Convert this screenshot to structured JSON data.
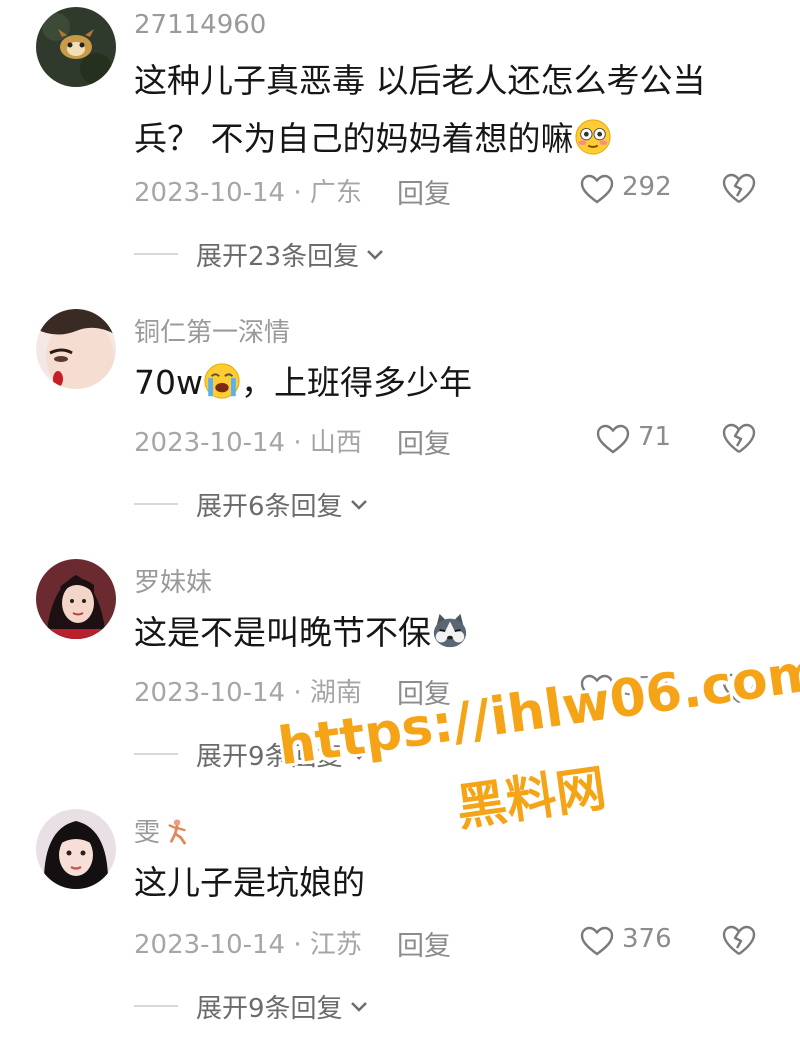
{
  "comments": [
    {
      "username": "27114960",
      "text": "这种儿子真恶毒 以后老人还怎么考公当兵？ 不为自己的妈妈着想的嘛",
      "emoji": "flushed-face-emoji",
      "date_location": "2023-10-14 · 广东",
      "reply_label": "回复",
      "likes": "292",
      "expand_label": "展开23条回复"
    },
    {
      "username": "铜仁第一深情",
      "text_before": "70w",
      "emoji": "loudly-crying-face-emoji",
      "text_after": "，上班得多少年",
      "date_location": "2023-10-14 · 山西",
      "reply_label": "回复",
      "likes": "71",
      "expand_label": "展开6条回复"
    },
    {
      "username": "罗妹妹",
      "text": "这是不是叫晚节不保",
      "emoji": "husky-dog-emoji",
      "date_location": "2023-10-14 · 湖南",
      "reply_label": "回复",
      "likes": "377",
      "expand_label": "展开9条回复"
    },
    {
      "username": "雯",
      "username_emoji": "dancing-figure-emoji",
      "text": "这儿子是坑娘的",
      "date_location": "2023-10-14 · 江苏",
      "reply_label": "回复",
      "likes": "376",
      "expand_label": "展开9条回复"
    }
  ],
  "watermark": {
    "line1": "https://ihlw06.com",
    "line2": "黑料网"
  },
  "colors": {
    "text_primary": "#161616",
    "text_secondary": "#a6a6a6",
    "watermark": "#f5a417"
  }
}
